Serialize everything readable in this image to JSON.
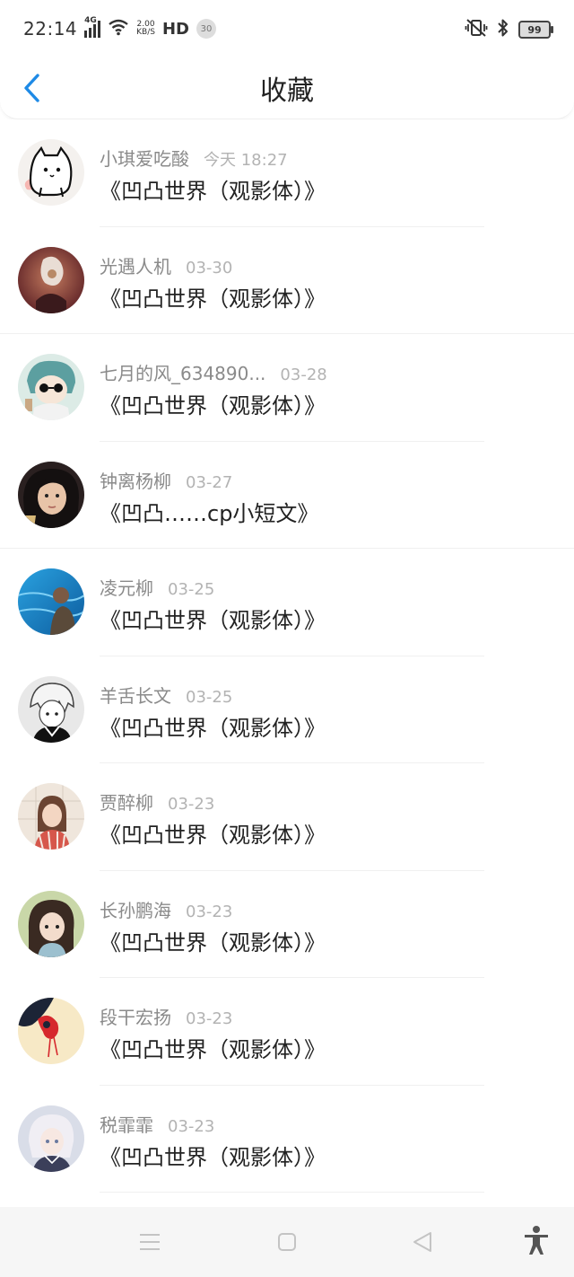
{
  "status_bar": {
    "time": "22:14",
    "network": "4G",
    "speed_value": "2.00",
    "speed_unit": "KB/S",
    "hd": "HD",
    "notification_count": "30",
    "battery": "99"
  },
  "header": {
    "title": "收藏"
  },
  "favorites": [
    {
      "author": "小琪爱吃酸",
      "time": "今天 18:27",
      "title": "《凹凸世界（观影体）》"
    },
    {
      "author": "光遇人机",
      "time": "03-30",
      "title": "《凹凸世界（观影体）》"
    },
    {
      "author": "七月的风_634890...",
      "time": "03-28",
      "title": "《凹凸世界（观影体）》"
    },
    {
      "author": "钟离杨柳",
      "time": "03-27",
      "title": "《凹凸……cp小短文》"
    },
    {
      "author": "凌元柳",
      "time": "03-25",
      "title": "《凹凸世界（观影体）》"
    },
    {
      "author": "羊舌长文",
      "time": "03-25",
      "title": "《凹凸世界（观影体）》"
    },
    {
      "author": "贾醉柳",
      "time": "03-23",
      "title": "《凹凸世界（观影体）》"
    },
    {
      "author": "长孙鹏海",
      "time": "03-23",
      "title": "《凹凸世界（观影体）》"
    },
    {
      "author": "段干宏扬",
      "time": "03-23",
      "title": "《凹凸世界（观影体）》"
    },
    {
      "author": "税霏霏",
      "time": "03-23",
      "title": "《凹凸世界（观影体）》"
    }
  ],
  "icons": {
    "back": "chevron-left-icon",
    "menu": "menu-icon",
    "home": "square-home-icon",
    "back_nav": "triangle-back-icon",
    "accessibility": "accessibility-icon"
  },
  "colors": {
    "accent": "#1e8ae6",
    "meta_text": "#8a8a8a",
    "time_text": "#b3b3b3"
  }
}
